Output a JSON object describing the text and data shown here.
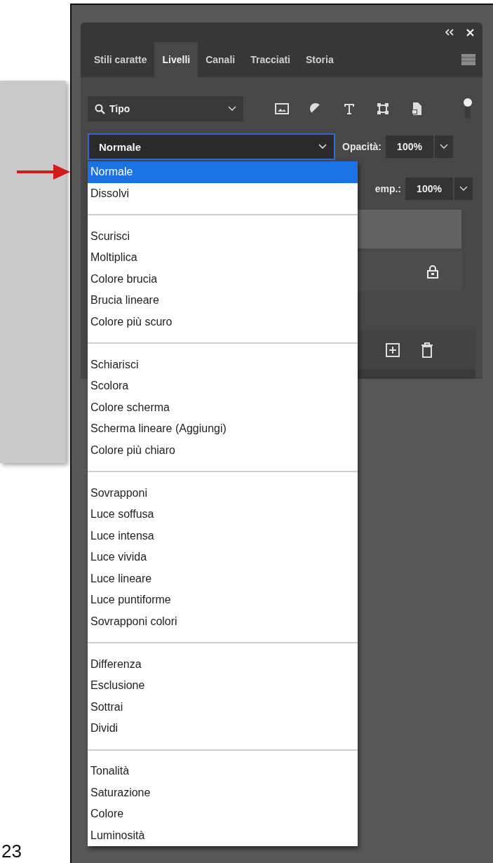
{
  "tabs": [
    {
      "label": "Stili caratte",
      "selected": false
    },
    {
      "label": "Livelli",
      "selected": true
    },
    {
      "label": "Canali",
      "selected": false
    },
    {
      "label": "Tracciati",
      "selected": false
    },
    {
      "label": "Storia",
      "selected": false
    }
  ],
  "filter": {
    "value": "Tipo"
  },
  "blend_mode": {
    "value": "Normale",
    "open": true
  },
  "opacity": {
    "label": "Opacità:",
    "value": "100%"
  },
  "fill": {
    "label": "emp.:",
    "value": "100%"
  },
  "layers": [
    {
      "selected": true,
      "locked": false
    },
    {
      "selected": false,
      "locked": true
    }
  ],
  "blend_menu": {
    "groups": [
      {
        "items": [
          {
            "label": "Normale",
            "selected": true
          },
          {
            "label": "Dissolvi",
            "selected": false
          }
        ]
      },
      {
        "items": [
          {
            "label": "Scurisci",
            "selected": false
          },
          {
            "label": "Moltiplica",
            "selected": false
          },
          {
            "label": "Colore brucia",
            "selected": false
          },
          {
            "label": "Brucia lineare",
            "selected": false
          },
          {
            "label": "Colore più scuro",
            "selected": false
          }
        ]
      },
      {
        "items": [
          {
            "label": "Schiarisci",
            "selected": false
          },
          {
            "label": "Scolora",
            "selected": false
          },
          {
            "label": "Colore scherma",
            "selected": false
          },
          {
            "label": "Scherma lineare (Aggiungi)",
            "selected": false
          },
          {
            "label": "Colore più chiaro",
            "selected": false
          }
        ]
      },
      {
        "items": [
          {
            "label": "Sovrapponi",
            "selected": false
          },
          {
            "label": "Luce soffusa",
            "selected": false
          },
          {
            "label": "Luce intensa",
            "selected": false
          },
          {
            "label": "Luce vivida",
            "selected": false
          },
          {
            "label": "Luce lineare",
            "selected": false
          },
          {
            "label": "Luce puntiforme",
            "selected": false
          },
          {
            "label": "Sovrapponi colori",
            "selected": false
          }
        ]
      },
      {
        "items": [
          {
            "label": "Differenza",
            "selected": false
          },
          {
            "label": "Esclusione",
            "selected": false
          },
          {
            "label": "Sottrai",
            "selected": false
          },
          {
            "label": "Dividi",
            "selected": false
          }
        ]
      },
      {
        "items": [
          {
            "label": "Tonalità",
            "selected": false
          },
          {
            "label": "Saturazione",
            "selected": false
          },
          {
            "label": "Colore",
            "selected": false
          },
          {
            "label": "Luminosità",
            "selected": false
          }
        ]
      }
    ]
  },
  "page_number": "23"
}
